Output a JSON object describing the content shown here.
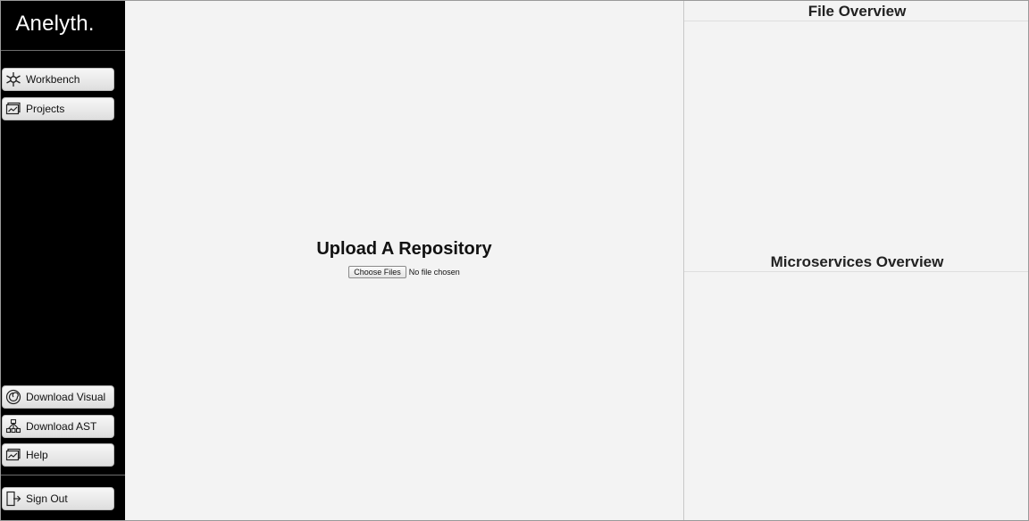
{
  "sidebar": {
    "logo": "Anelyth.",
    "nav_top": [
      {
        "label": "Workbench",
        "icon": "workbench-icon"
      },
      {
        "label": "Projects",
        "icon": "projects-icon"
      }
    ],
    "nav_bottom": [
      {
        "label": "Download Visual",
        "icon": "download-visual-icon"
      },
      {
        "label": "Download AST",
        "icon": "download-ast-icon"
      },
      {
        "label": "Help",
        "icon": "help-icon"
      }
    ],
    "sign_out": {
      "label": "Sign Out",
      "icon": "sign-out-icon"
    }
  },
  "main": {
    "title": "Upload A Repository",
    "file_input": {
      "button_label": "Choose Files",
      "status": "No file chosen"
    }
  },
  "right_panel": {
    "file_overview_title": "File Overview",
    "microservices_overview_title": "Microservices Overview"
  },
  "colors": {
    "sidebar_bg": "#000000",
    "main_bg": "#f3f3f3",
    "button_bg": "#e6e6e6"
  }
}
